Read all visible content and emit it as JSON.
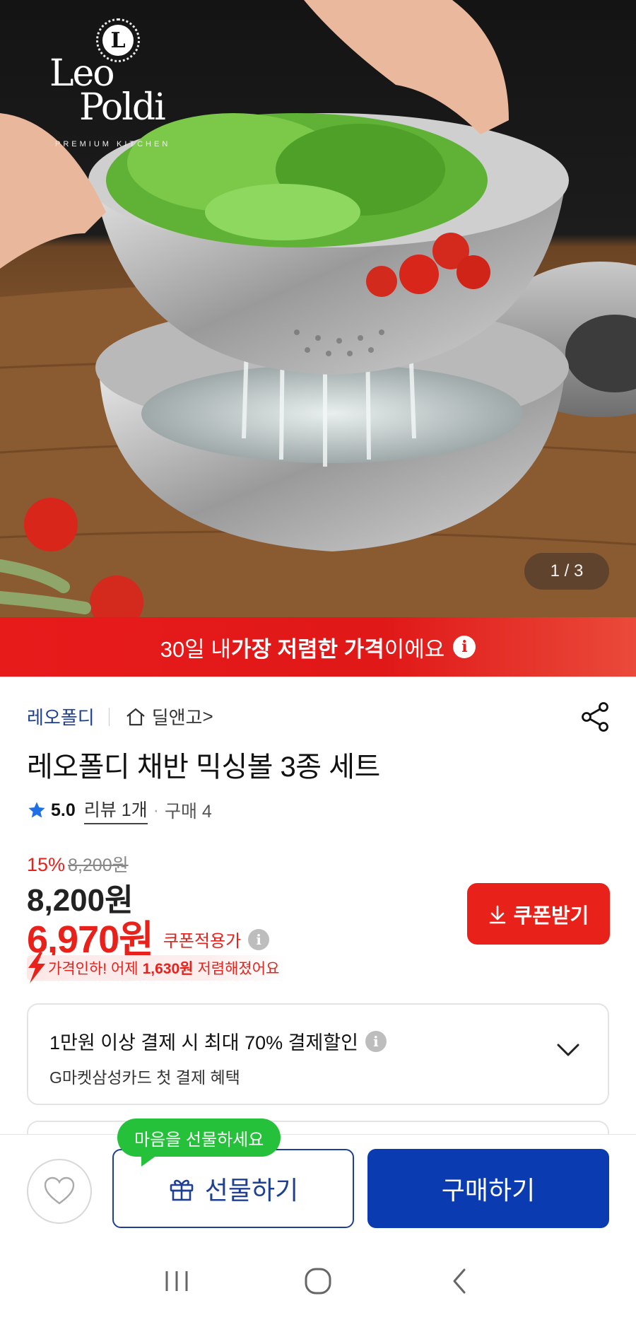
{
  "hero": {
    "brand_logo": {
      "line1": "Leo",
      "line2": "Poldi",
      "tagline": "PREMIUM KITCHEN",
      "mark": "L"
    },
    "image_counter": "1 / 3"
  },
  "banner": {
    "text_before": "30일 내 ",
    "text_bold": "가장 저렴한 가격",
    "text_after": "이에요",
    "icon": "info-icon"
  },
  "product": {
    "brand": "레오폴디",
    "store": "딜앤고",
    "store_arrow": ">",
    "title": "레오폴디 채반 믹싱볼 3종 세트",
    "rating": "5.0",
    "review_link": "리뷰 1개",
    "separator": "·",
    "purchase_count": "구매 4",
    "discount_percent": "15%",
    "original_price": "8,200원",
    "price": "8,200원",
    "coupon_price": "6,970원",
    "coupon_label": "쿠폰적용가",
    "price_drop": {
      "prefix": "가격인하! 어제",
      "amount": "1,630원",
      "suffix": "저렴해졌어요"
    },
    "coupon_button": "쿠폰받기"
  },
  "payment_benefit": {
    "title": "1만원 이상 결제 시 최대 70% 결제할인",
    "subtitle": "G마켓삼성카드 첫 결제 혜택"
  },
  "action_bar": {
    "gift_tooltip": "마음을 선물하세요",
    "gift_button": "선물하기",
    "buy_button": "구매하기"
  },
  "colors": {
    "accent_red": "#e8221b",
    "brand_blue": "#1d3f94",
    "buy_blue": "#0b3bb0",
    "tooltip_green": "#26c13a"
  }
}
